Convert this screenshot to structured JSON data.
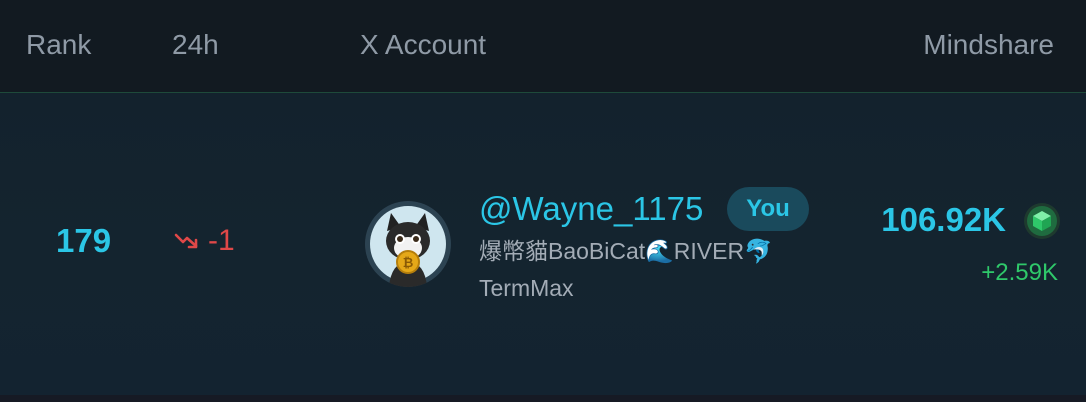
{
  "header": {
    "rank": "Rank",
    "change_24h": "24h",
    "account": "X Account",
    "mindshare": "Mindshare"
  },
  "row": {
    "rank": "179",
    "change": "-1",
    "change_direction_icon": "trend-down-icon",
    "handle": "@Wayne_1175",
    "badge": "You",
    "display_name": "爆幣貓BaoBiCat🌊RIVER🐬",
    "sub_name": "TermMax",
    "mindshare_value": "106.92K",
    "mindshare_delta": "+2.59K",
    "mindshare_icon": "green-cube-icon"
  },
  "colors": {
    "accent": "#2bc6e6",
    "negative": "#e04848",
    "positive": "#2fc86a",
    "header_text": "#8f9aa6",
    "background": "#10181f"
  }
}
